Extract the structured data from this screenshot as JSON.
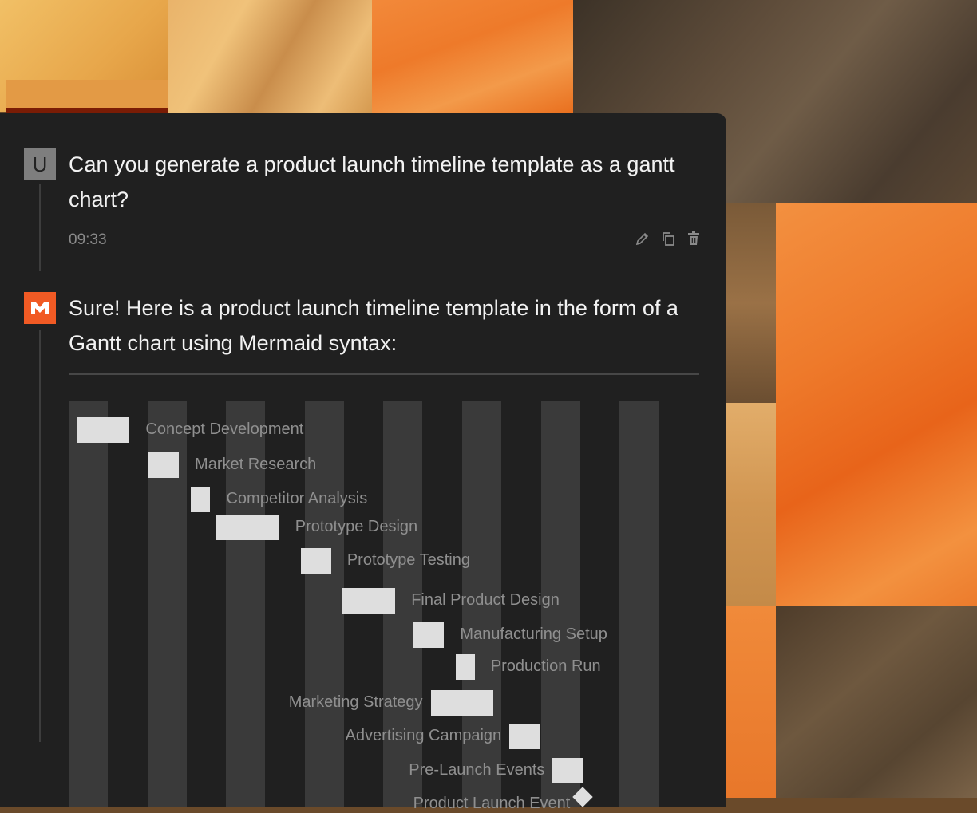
{
  "conversation": {
    "user_avatar_letter": "U",
    "user_message": "Can you generate a product launch timeline template as a gantt chart?",
    "user_time": "09:33",
    "actions": [
      "edit-icon",
      "copy-icon",
      "delete-icon"
    ],
    "ai_message": "Sure! Here is a product launch timeline template in the form of a Gantt chart using Mermaid syntax:"
  },
  "colors": {
    "panel_bg": "#202020",
    "ai_avatar": "#f15a24",
    "bar": "#dedede",
    "column": "#3a3a3a",
    "label": "#8f8f8f"
  },
  "chart_data": {
    "type": "gantt",
    "tasks": [
      {
        "name": "Concept Development",
        "start": 0.2,
        "end": 1.55
      },
      {
        "name": "Market Research",
        "start": 2.03,
        "end": 2.8
      },
      {
        "name": "Competitor Analysis",
        "start": 3.1,
        "end": 3.6
      },
      {
        "name": "Prototype Design",
        "start": 3.75,
        "end": 5.35
      },
      {
        "name": "Prototype Testing",
        "start": 5.9,
        "end": 6.67
      },
      {
        "name": "Final Product Design",
        "start": 6.95,
        "end": 8.3
      },
      {
        "name": "Manufacturing Setup",
        "start": 8.77,
        "end": 9.54
      },
      {
        "name": "Production Run",
        "start": 9.83,
        "end": 10.32
      },
      {
        "name": "Marketing Strategy",
        "start": 9.2,
        "end": 10.8
      },
      {
        "name": "Advertising Campaign",
        "start": 11.2,
        "end": 11.97
      },
      {
        "name": "Pre-Launch Events",
        "start": 12.3,
        "end": 13.07
      },
      {
        "name": "Product Launch Event",
        "start": 13.07,
        "end": 13.07,
        "milestone": true
      }
    ]
  }
}
